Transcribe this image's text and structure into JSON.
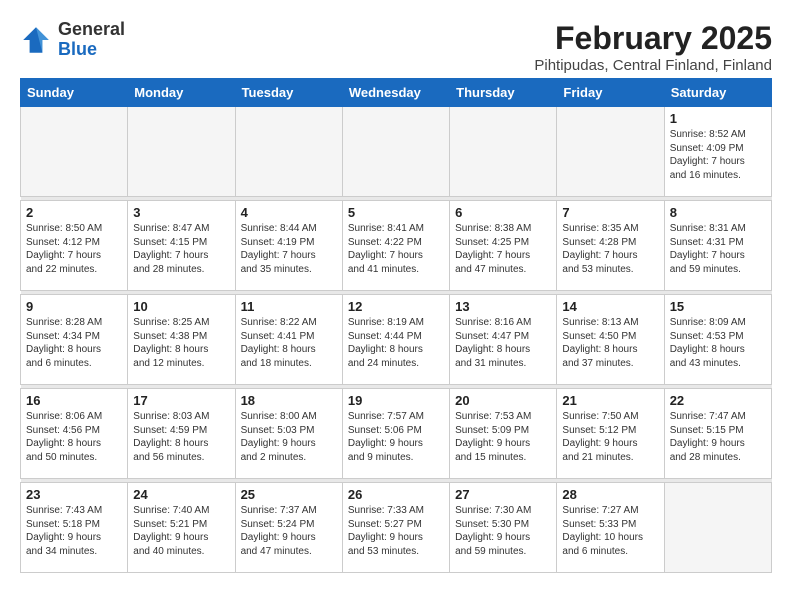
{
  "logo": {
    "general": "General",
    "blue": "Blue"
  },
  "title": "February 2025",
  "subtitle": "Pihtipudas, Central Finland, Finland",
  "days_of_week": [
    "Sunday",
    "Monday",
    "Tuesday",
    "Wednesday",
    "Thursday",
    "Friday",
    "Saturday"
  ],
  "weeks": [
    [
      {
        "num": "",
        "info": "",
        "empty": true
      },
      {
        "num": "",
        "info": "",
        "empty": true
      },
      {
        "num": "",
        "info": "",
        "empty": true
      },
      {
        "num": "",
        "info": "",
        "empty": true
      },
      {
        "num": "",
        "info": "",
        "empty": true
      },
      {
        "num": "",
        "info": "",
        "empty": true
      },
      {
        "num": "1",
        "info": "Sunrise: 8:52 AM\nSunset: 4:09 PM\nDaylight: 7 hours\nand 16 minutes.",
        "empty": false
      }
    ],
    [
      {
        "num": "2",
        "info": "Sunrise: 8:50 AM\nSunset: 4:12 PM\nDaylight: 7 hours\nand 22 minutes.",
        "empty": false
      },
      {
        "num": "3",
        "info": "Sunrise: 8:47 AM\nSunset: 4:15 PM\nDaylight: 7 hours\nand 28 minutes.",
        "empty": false
      },
      {
        "num": "4",
        "info": "Sunrise: 8:44 AM\nSunset: 4:19 PM\nDaylight: 7 hours\nand 35 minutes.",
        "empty": false
      },
      {
        "num": "5",
        "info": "Sunrise: 8:41 AM\nSunset: 4:22 PM\nDaylight: 7 hours\nand 41 minutes.",
        "empty": false
      },
      {
        "num": "6",
        "info": "Sunrise: 8:38 AM\nSunset: 4:25 PM\nDaylight: 7 hours\nand 47 minutes.",
        "empty": false
      },
      {
        "num": "7",
        "info": "Sunrise: 8:35 AM\nSunset: 4:28 PM\nDaylight: 7 hours\nand 53 minutes.",
        "empty": false
      },
      {
        "num": "8",
        "info": "Sunrise: 8:31 AM\nSunset: 4:31 PM\nDaylight: 7 hours\nand 59 minutes.",
        "empty": false
      }
    ],
    [
      {
        "num": "9",
        "info": "Sunrise: 8:28 AM\nSunset: 4:34 PM\nDaylight: 8 hours\nand 6 minutes.",
        "empty": false
      },
      {
        "num": "10",
        "info": "Sunrise: 8:25 AM\nSunset: 4:38 PM\nDaylight: 8 hours\nand 12 minutes.",
        "empty": false
      },
      {
        "num": "11",
        "info": "Sunrise: 8:22 AM\nSunset: 4:41 PM\nDaylight: 8 hours\nand 18 minutes.",
        "empty": false
      },
      {
        "num": "12",
        "info": "Sunrise: 8:19 AM\nSunset: 4:44 PM\nDaylight: 8 hours\nand 24 minutes.",
        "empty": false
      },
      {
        "num": "13",
        "info": "Sunrise: 8:16 AM\nSunset: 4:47 PM\nDaylight: 8 hours\nand 31 minutes.",
        "empty": false
      },
      {
        "num": "14",
        "info": "Sunrise: 8:13 AM\nSunset: 4:50 PM\nDaylight: 8 hours\nand 37 minutes.",
        "empty": false
      },
      {
        "num": "15",
        "info": "Sunrise: 8:09 AM\nSunset: 4:53 PM\nDaylight: 8 hours\nand 43 minutes.",
        "empty": false
      }
    ],
    [
      {
        "num": "16",
        "info": "Sunrise: 8:06 AM\nSunset: 4:56 PM\nDaylight: 8 hours\nand 50 minutes.",
        "empty": false
      },
      {
        "num": "17",
        "info": "Sunrise: 8:03 AM\nSunset: 4:59 PM\nDaylight: 8 hours\nand 56 minutes.",
        "empty": false
      },
      {
        "num": "18",
        "info": "Sunrise: 8:00 AM\nSunset: 5:03 PM\nDaylight: 9 hours\nand 2 minutes.",
        "empty": false
      },
      {
        "num": "19",
        "info": "Sunrise: 7:57 AM\nSunset: 5:06 PM\nDaylight: 9 hours\nand 9 minutes.",
        "empty": false
      },
      {
        "num": "20",
        "info": "Sunrise: 7:53 AM\nSunset: 5:09 PM\nDaylight: 9 hours\nand 15 minutes.",
        "empty": false
      },
      {
        "num": "21",
        "info": "Sunrise: 7:50 AM\nSunset: 5:12 PM\nDaylight: 9 hours\nand 21 minutes.",
        "empty": false
      },
      {
        "num": "22",
        "info": "Sunrise: 7:47 AM\nSunset: 5:15 PM\nDaylight: 9 hours\nand 28 minutes.",
        "empty": false
      }
    ],
    [
      {
        "num": "23",
        "info": "Sunrise: 7:43 AM\nSunset: 5:18 PM\nDaylight: 9 hours\nand 34 minutes.",
        "empty": false
      },
      {
        "num": "24",
        "info": "Sunrise: 7:40 AM\nSunset: 5:21 PM\nDaylight: 9 hours\nand 40 minutes.",
        "empty": false
      },
      {
        "num": "25",
        "info": "Sunrise: 7:37 AM\nSunset: 5:24 PM\nDaylight: 9 hours\nand 47 minutes.",
        "empty": false
      },
      {
        "num": "26",
        "info": "Sunrise: 7:33 AM\nSunset: 5:27 PM\nDaylight: 9 hours\nand 53 minutes.",
        "empty": false
      },
      {
        "num": "27",
        "info": "Sunrise: 7:30 AM\nSunset: 5:30 PM\nDaylight: 9 hours\nand 59 minutes.",
        "empty": false
      },
      {
        "num": "28",
        "info": "Sunrise: 7:27 AM\nSunset: 5:33 PM\nDaylight: 10 hours\nand 6 minutes.",
        "empty": false
      },
      {
        "num": "",
        "info": "",
        "empty": true
      }
    ]
  ]
}
